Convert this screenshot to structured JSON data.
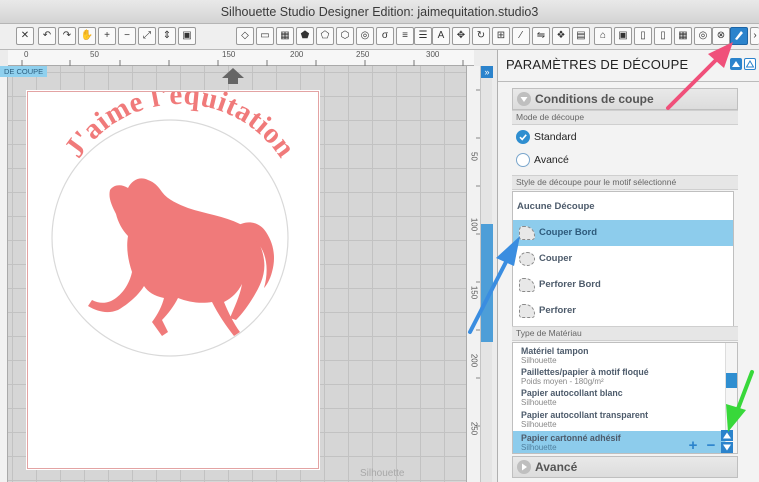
{
  "window": {
    "title": "Silhouette Studio Designer Edition: jaimequitation.studio3"
  },
  "toolbar": {
    "text_tool_label": "A"
  },
  "canvas": {
    "tab_label": "DE COUPE",
    "ruler_top": [
      "0",
      "50",
      "150",
      "200",
      "250",
      "300"
    ],
    "ruler_right": [
      "50",
      "100",
      "150",
      "200",
      "250"
    ],
    "design_text": "J'aime l'équitation",
    "colors": {
      "design": "#f07a7a",
      "circle": "#d9d9d9"
    },
    "watermark": "Silhouette"
  },
  "panel": {
    "title": "PARAMÈTRES DE DÉCOUPE",
    "conditions_header": "Conditions de coupe",
    "mode_label": "Mode de découpe",
    "modes": [
      {
        "label": "Standard",
        "selected": true
      },
      {
        "label": "Avancé",
        "selected": false
      }
    ],
    "style_label": "Style de découpe pour le motif sélectionné",
    "styles": [
      {
        "label": "Aucune Découpe"
      },
      {
        "label": "Couper Bord"
      },
      {
        "label": "Couper"
      },
      {
        "label": "Perforer Bord"
      },
      {
        "label": "Perforer"
      }
    ],
    "material_label": "Type de Matériau",
    "materials": [
      {
        "name": "Matériel tampon",
        "sub": "Silhouette"
      },
      {
        "name": "Paillettes/papier à motif floqué",
        "sub": "Poids moyen - 180g/m²"
      },
      {
        "name": "Papier autocollant blanc",
        "sub": "Silhouette"
      },
      {
        "name": "Papier autocollant transparent",
        "sub": "Silhouette"
      },
      {
        "name": "Papier cartonné  adhésif",
        "sub": "Silhouette"
      }
    ],
    "add_label": "+",
    "remove_label": "−",
    "advanced_header": "Avancé"
  },
  "annotations": {
    "arrow_colors": [
      "#f0507a",
      "#3a8de0",
      "#38d83a"
    ]
  }
}
